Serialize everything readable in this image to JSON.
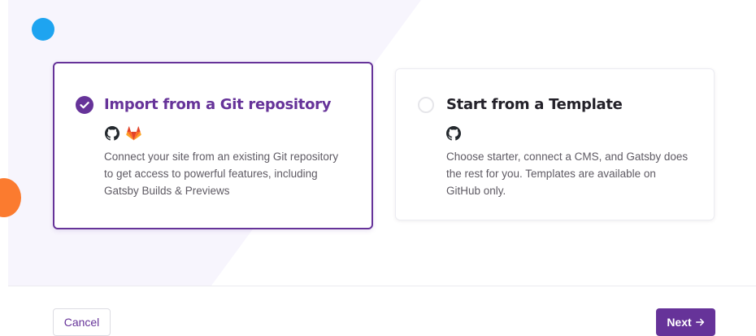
{
  "options": {
    "git": {
      "title": "Import from a Git repository",
      "description": "Connect your site from an existing Git repository to get access to powerful features, including Gatsby Builds & Previews",
      "selected": true,
      "icons": [
        "github-icon",
        "gitlab-icon"
      ]
    },
    "template": {
      "title": "Start from a Template",
      "description": "Choose starter, connect a CMS, and Gatsby does the rest for you. Templates are available on GitHub only.",
      "selected": false,
      "icons": [
        "github-icon"
      ]
    }
  },
  "footer": {
    "cancel_label": "Cancel",
    "next_label": "Next",
    "next_icon": "arrow-right-icon"
  },
  "colors": {
    "accent": "#663399",
    "background_shape": "#f7f5fd",
    "decor_blue": "#1ea4f0",
    "decor_orange": "#fb7b2f",
    "gitlab_orange": "#e24329"
  }
}
